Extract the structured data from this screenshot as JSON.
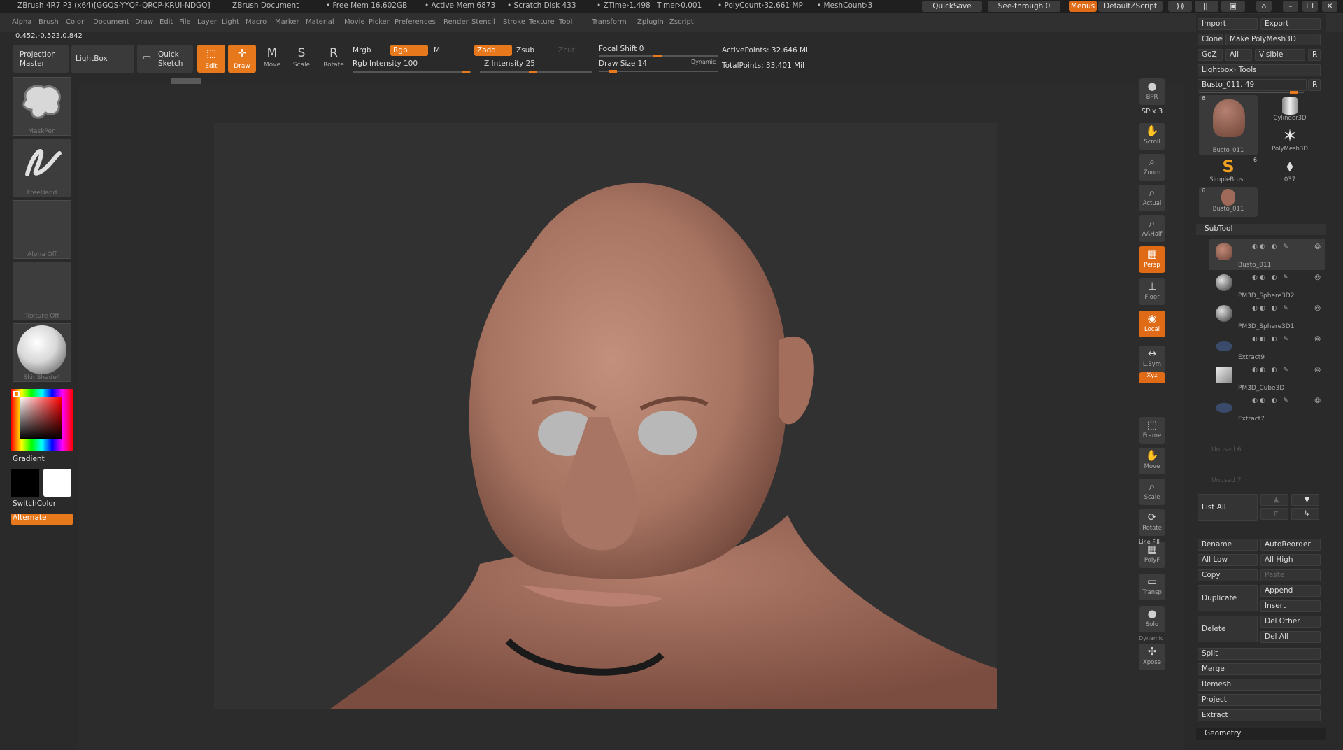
{
  "title": {
    "app": "ZBrush 4R7 P3 (x64)[GGQS-YYQF-QRCP-KRUI-NDGQ]",
    "doc": "ZBrush Document",
    "free_mem": "• Free Mem 16.602GB",
    "active_mem": "• Active Mem 6873",
    "scratch": "• Scratch Disk 433",
    "ztime": "• ZTime›1.498",
    "timer": "Timer›0.001",
    "polycount": "• PolyCount›32.661 MP",
    "meshcount": "• MeshCount›3",
    "quicksave": "QuickSave",
    "seethrough": "See-through  0",
    "menus": "Menus",
    "script": "DefaultZScript"
  },
  "menubar": [
    "Alpha",
    "Brush",
    "Color",
    "Document",
    "Draw",
    "Edit",
    "File",
    "Layer",
    "Light",
    "Macro",
    "Marker",
    "Material",
    "Movie",
    "Picker",
    "Preferences",
    "Render",
    "Stencil",
    "Stroke",
    "Texture",
    "Tool",
    "Transform",
    "Zplugin",
    "Zscript"
  ],
  "coords": "0.452,-0.523,0.842",
  "toolbar": {
    "projection_master": [
      "Projection",
      "Master"
    ],
    "lightbox": "LightBox",
    "quick_sketch": [
      "Quick",
      "Sketch"
    ],
    "edit": "Edit",
    "draw": "Draw",
    "move": "Move",
    "scale": "Scale",
    "rotate": "Rotate",
    "mrgb": "Mrgb",
    "rgb": "Rgb",
    "m": "M",
    "rgb_intensity": "Rgb Intensity 100",
    "zadd": "Zadd",
    "zsub": "Zsub",
    "zcut": "Zcut",
    "z_intensity": "Z Intensity 25",
    "focal_shift": "Focal Shift 0",
    "draw_size": "Draw Size 14",
    "dynamic": "Dynamic",
    "active_points": "ActivePoints: 32.646 Mil",
    "total_points": "TotalPoints: 33.401 Mil"
  },
  "leftshelf": {
    "brush": "MaskPen",
    "stroke": "FreeHand",
    "alpha": "Alpha Off",
    "texture": "Texture Off",
    "material": "SkinShade4",
    "gradient": "Gradient",
    "switchcolor": "SwitchColor",
    "alternate": "Alternate"
  },
  "rightshelf": [
    "BPR",
    "SPix 3",
    "Scroll",
    "Zoom",
    "Actual",
    "AAHalf",
    "Persp",
    "Floor",
    "Local",
    "L.Sym",
    "Xyz",
    "Frame",
    "Move",
    "Scale",
    "Rotate",
    "PolyF",
    "Transp",
    "Solo",
    "Xpose"
  ],
  "rightshelf_extra": {
    "dynamic": "Dynamic",
    "linefill": "Line Fill"
  },
  "panel": {
    "import": "Import",
    "export": "Export",
    "clone": "Clone",
    "make_polymesh": "Make PolyMesh3D",
    "goz": "GoZ",
    "all": "All",
    "visible": "Visible",
    "r": "R",
    "lightbox_tools": "Lightbox› Tools",
    "tool_name": "Busto_011. 49",
    "tools": [
      {
        "name": "Busto_011",
        "badge": "6"
      },
      {
        "name": "Cylinder3D",
        "badge": ""
      },
      {
        "name": "PolyMesh3D",
        "badge": ""
      },
      {
        "name": "SimpleBrush",
        "badge": ""
      },
      {
        "name": "037",
        "badge": "6"
      },
      {
        "name": "Busto_011",
        "badge": "6"
      }
    ],
    "subtool_header": "SubTool",
    "subtools": [
      "Busto_011",
      "PM3D_Sphere3D2",
      "PM3D_Sphere3D1",
      "Extract9",
      "PM3D_Cube3D",
      "Extract7",
      "Unused 6",
      "Unused 7"
    ],
    "list_all": "List All",
    "rename": "Rename",
    "autoreorder": "AutoReorder",
    "all_low": "All Low",
    "all_high": "All High",
    "copy": "Copy",
    "paste": "Paste",
    "duplicate": "Duplicate",
    "append": "Append",
    "insert": "Insert",
    "delete": "Delete",
    "del_other": "Del Other",
    "del_all": "Del All",
    "split": "Split",
    "merge": "Merge",
    "remesh": "Remesh",
    "project": "Project",
    "extract": "Extract",
    "geometry": "Geometry"
  },
  "colors": {
    "accent": "#e8781c",
    "bg": "#2a2a2a",
    "skin": "#b88676"
  }
}
